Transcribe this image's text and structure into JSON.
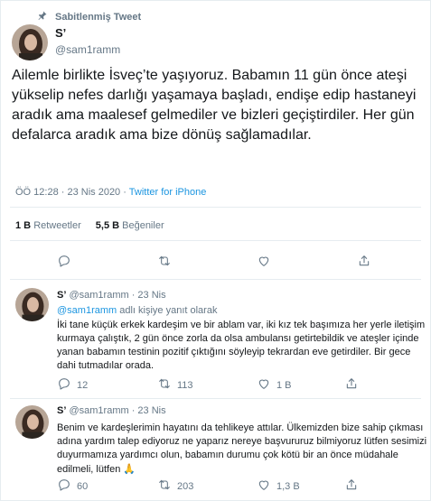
{
  "pinned_label": "Sabitlenmiş Tweet",
  "main": {
    "display_name": "S’",
    "handle": "@sam1ramm",
    "text": "Ailemle birlikte İsveç’te yaşıyoruz. Babamın 11 gün önce ateşi yükselip  nefes darlığı yaşamaya başladı, endişe edip hastaneyi aradık ama maalesef gelmediler ve bizleri geçiştirdiler.  Her gün defalarca aradık ama bize dönüş sağlamadılar.",
    "time_date": "ÖÖ 12:28 · 23 Nis 2020 · ",
    "source": "Twitter for iPhone",
    "retweets_count": "1 B",
    "retweets_label": "Retweetler",
    "likes_count": "5,5 B",
    "likes_label": "Beğeniler"
  },
  "replies": [
    {
      "display_name": "S’",
      "handle_time": "@sam1ramm · 23 Nis",
      "mention": "@sam1ramm",
      "replying_suffix": " adlı kişiye yanıt olarak",
      "text": "İki tane küçük erkek kardeşim ve bir ablam var, iki kız tek başımıza her yerle iletişim kurmaya çalıştık, 2 gün önce zorla da olsa ambulansı getirtebildik ve ateşler içinde yanan babamın testinin pozitif çıktığını söyleyip tekrardan eve getirdiler. Bir gece dahi tutmadılar orada.",
      "replies_count": "12",
      "retweets_count": "113",
      "likes_count": "1 B"
    },
    {
      "display_name": "S’",
      "handle_time": "@sam1ramm · 23 Nis",
      "text": "Benim ve kardeşlerimin hayatını da tehlikeye attılar. Ülkemizden bize sahip çıkması adına yardım talep ediyoruz ne yaparız nereye başvururuz bilmiyoruz lütfen sesimizi duyurmamıza yardımcı olun, babamın durumu çok kötü bir an önce müdahale edilmeli, lütfen ",
      "emoji": "🙏",
      "replies_count": "60",
      "retweets_count": "203",
      "likes_count": "1,3 B"
    }
  ],
  "colors": {
    "text": "#14171a",
    "secondary": "#657786",
    "link": "#1b95e0",
    "divider": "#e6ecf0"
  },
  "icons": [
    "pin-icon",
    "reply-icon",
    "retweet-icon",
    "like-icon",
    "share-icon"
  ]
}
